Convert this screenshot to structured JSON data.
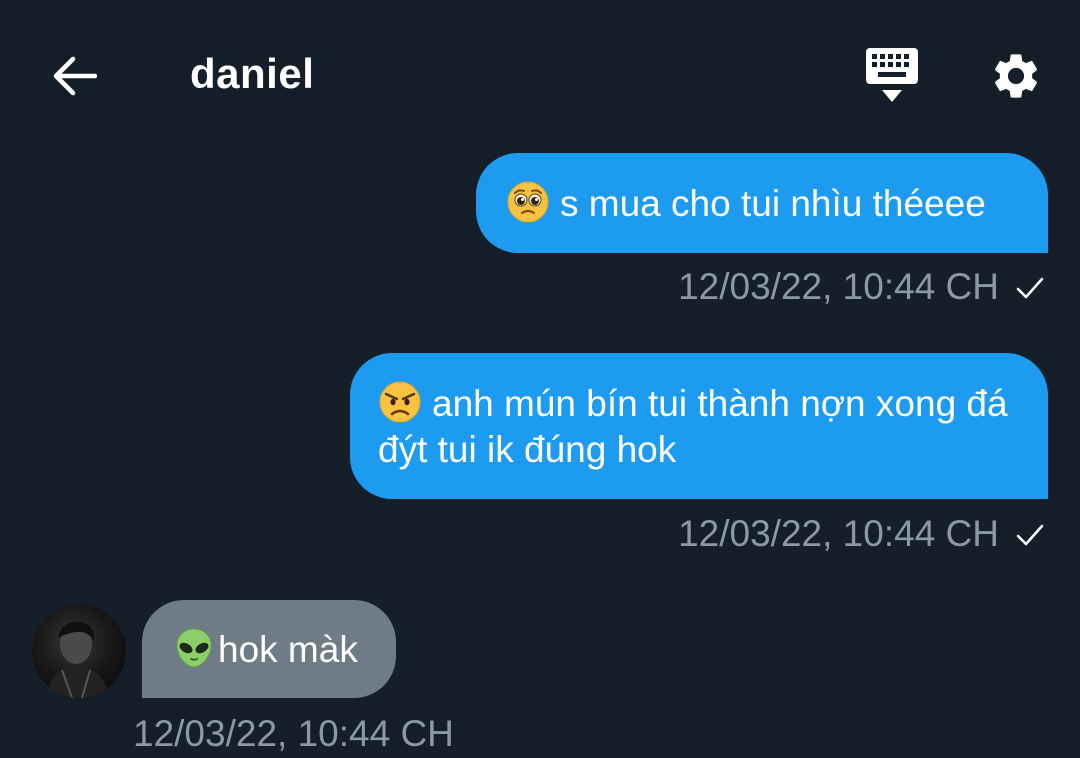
{
  "header": {
    "title": "daniel",
    "back_icon": "arrow-left-icon",
    "keyboard_icon": "keyboard-icon",
    "settings_icon": "gear-icon"
  },
  "messages": [
    {
      "direction": "outgoing",
      "emoji": "pleading-face-emoji",
      "text": "s mua cho tui nhìu théeee",
      "timestamp": "12/03/22, 10:44 CH",
      "status_icon": "check-icon"
    },
    {
      "direction": "outgoing",
      "emoji": "angry-face-emoji",
      "text": "anh mún bín tui thành nợn xong đá đýt tui ik đúng hok",
      "timestamp": "12/03/22, 10:44 CH",
      "status_icon": "check-icon"
    },
    {
      "direction": "incoming",
      "emoji": "alien-emoji",
      "text": "hok màk",
      "timestamp": "12/03/22, 10:44 CH"
    }
  ],
  "colors": {
    "background": "#151f2a",
    "outgoing_bubble": "#1d9bf0",
    "incoming_bubble": "#6f7c87",
    "timestamp": "#8b98a5",
    "text": "#ffffff"
  }
}
